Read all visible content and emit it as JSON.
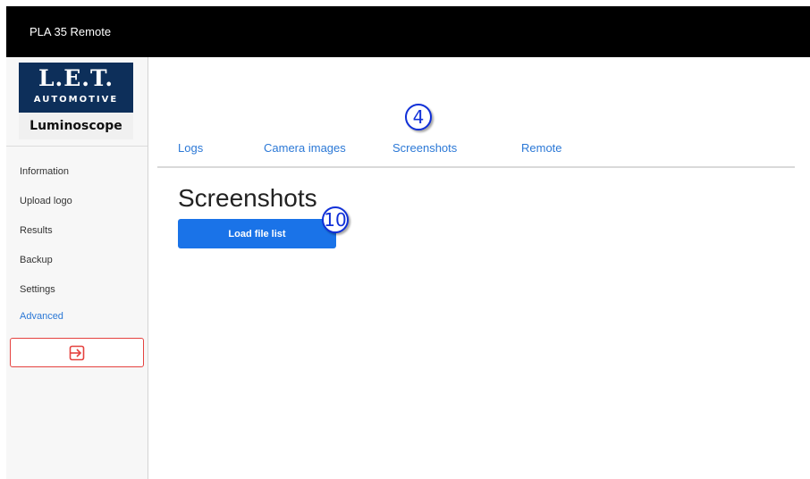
{
  "app": {
    "title": "PLA 35 Remote"
  },
  "logo": {
    "brand": "L.E.T.",
    "subtitle": "AUTOMOTIVE",
    "product": "Luminoscope"
  },
  "sidebar": {
    "items": [
      {
        "label": "Information",
        "active": false
      },
      {
        "label": "Upload logo",
        "active": false
      },
      {
        "label": "Results",
        "active": false
      },
      {
        "label": "Backup",
        "active": false
      },
      {
        "label": "Settings",
        "active": false
      },
      {
        "label": "Advanced",
        "active": true
      }
    ],
    "logout_icon": "logout-arrow-icon"
  },
  "tabs": [
    {
      "label": "Logs"
    },
    {
      "label": "Camera images"
    },
    {
      "label": "Screenshots"
    },
    {
      "label": "Remote"
    }
  ],
  "annotations": {
    "tab_marker": "4",
    "button_marker": "10"
  },
  "main": {
    "title": "Screenshots",
    "load_button": "Load file list"
  },
  "colors": {
    "titlebar": "#000000",
    "accent": "#2b78d6",
    "button": "#1a73e8",
    "logout_border": "#e5423f",
    "marker": "#1030d8"
  }
}
